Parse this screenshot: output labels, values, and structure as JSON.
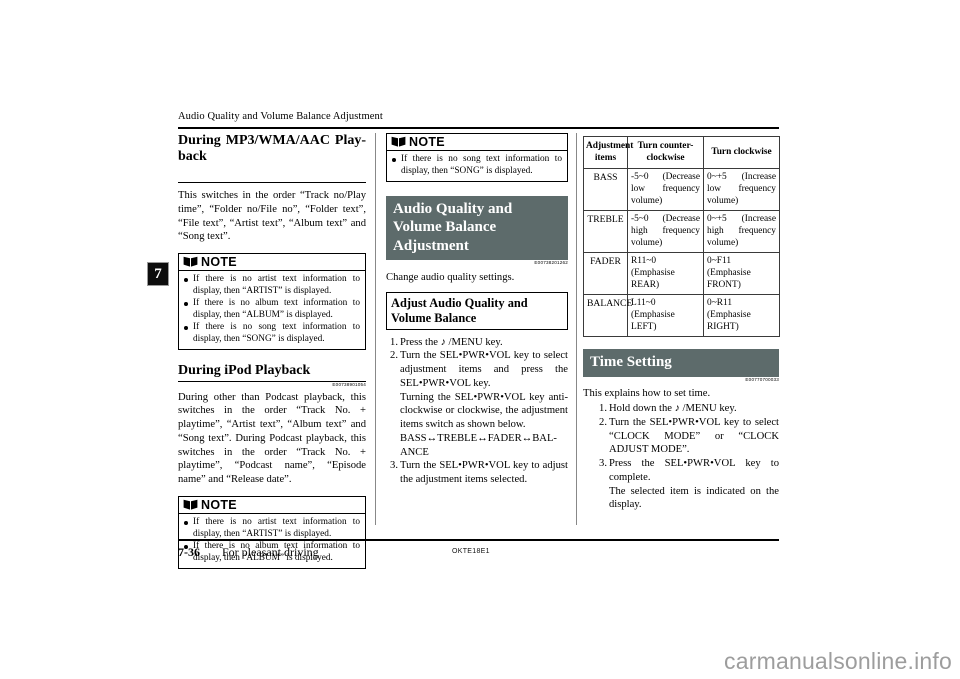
{
  "header": {
    "running_title": "Audio Quality and Volume Balance Adjustment"
  },
  "chapter_tab": {
    "number": "7"
  },
  "column1": {
    "heading1": "During MP3/WMA/AAC Play-back",
    "paragraph1": "This switches in the order “Track no/Play time”, “Folder no/File no”, “Folder text”, “File text”, “Artist text”, “Album text” and “Song text”.",
    "note1": {
      "label": "NOTE",
      "icon": "open-book-icon",
      "items": [
        "If there is no artist text information to display, then “ARTIST” is displayed.",
        "If there is no album text information to display, then “ALBUM” is displayed.",
        "If there is no song text information to display, then “SONG” is displayed."
      ]
    },
    "heading2": "During iPod Playback",
    "refcode2": "E00738901054",
    "paragraph2": "During other than Podcast playback, this switches in the order “Track No. + playtime”, “Artist text”, “Album text” and “Song text”. During Podcast playback, this switches in the order “Track No. + playtime”, “Podcast name”, “Episode name” and “Release date”.",
    "note2": {
      "label": "NOTE",
      "icon": "open-book-icon",
      "items": [
        "If there is no artist text information to display, then “ARTIST” is displayed.",
        "If there is no album text information to display, then “ALBUM” is displayed."
      ]
    }
  },
  "column2": {
    "note3": {
      "label": "NOTE",
      "icon": "open-book-icon",
      "items": [
        "If there is no song text information to display, then “SONG” is displayed."
      ]
    },
    "banner": "Audio Quality and Volume Balance Adjustment",
    "refcode": "E00738201262",
    "intro": "Change audio quality settings.",
    "subheading": "Adjust Audio Quality and Volume Balance",
    "steps": [
      {
        "lines": [
          "Press the ♪ /MENU key."
        ]
      },
      {
        "lines": [
          "Turn the SEL•PWR•VOL key to select adjustment items and press the SEL•PWR•VOL key.",
          "Turning the SEL•PWR•VOL key anti-clockwise or clockwise, the adjustment items switch as shown below.",
          "BASS↔TREBLE↔FADER↔BAL-ANCE"
        ]
      },
      {
        "lines": [
          "Turn the SEL•PWR•VOL key to adjust the adjustment items selected."
        ]
      }
    ]
  },
  "column3": {
    "table": {
      "headers": [
        "Adjustment items",
        "Turn counter-clockwise",
        "Turn clockwise"
      ],
      "rows": [
        {
          "item": "BASS",
          "ccw": "-5~0 (Decrease low frequency volume)",
          "cw": "0~+5 (Increase low frequency volume)"
        },
        {
          "item": "TREBLE",
          "ccw": "-5~0 (Decrease high frequency volume)",
          "cw": "0~+5 (Increase high frequency volume)"
        },
        {
          "item": "FADER",
          "ccw": "R11~0 (Emphasise REAR)",
          "cw": "0~F11 (Emphasise FRONT)"
        },
        {
          "item": "BALANCE",
          "ccw": "L11~0 (Emphasise LEFT)",
          "cw": "0~R11 (Emphasise RIGHT)"
        }
      ]
    },
    "banner": "Time Setting",
    "refcode": "E00770700033",
    "intro": "This explains how to set time.",
    "steps": [
      {
        "lines": [
          "Hold down the ♪ /MENU key."
        ]
      },
      {
        "lines": [
          "Turn the SEL•PWR•VOL key to select “CLOCK MODE” or “CLOCK ADJUST MODE”."
        ]
      },
      {
        "lines": [
          "Press the SEL•PWR•VOL key to complete.",
          "The selected item is indicated on the display."
        ]
      }
    ]
  },
  "footer": {
    "page_number": "7-36",
    "section": "For pleasant driving",
    "doc_id": "OKTE18E1"
  },
  "watermark": "carmanualsonline.info",
  "colors": {
    "banner_bg": "#5d6b6b",
    "banner_text": "#ffffff",
    "tab_bg": "#0d0d0d",
    "rule": "#000000",
    "watermark": "#9d9d9d"
  }
}
